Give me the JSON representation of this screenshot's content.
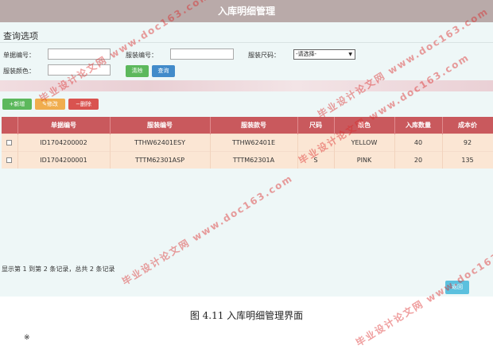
{
  "window": {
    "title": "入库明细管理"
  },
  "query": {
    "section_title": "查询选项",
    "doc_no_label": "单据编号：",
    "clothing_no_label": "服装编号：",
    "size_label": "服装尺码：",
    "size_selected": "-请选择-",
    "color_label": "服装颜色：",
    "clear_label": "清除",
    "search_label": "查询"
  },
  "toolbar": {
    "add_label": "+新增",
    "edit_label": "✎修改",
    "delete_label": "−删除"
  },
  "table": {
    "headers": [
      "",
      "单据编号",
      "服装编号",
      "服装款号",
      "尺码",
      "颜色",
      "入库数量",
      "成本价"
    ],
    "rows": [
      [
        "",
        "ID1704200002",
        "TTHW62401ESY",
        "TTHW62401E",
        "",
        "YELLOW",
        "40",
        "92"
      ],
      [
        "",
        "ID1704200001",
        "TTTM62301ASP",
        "TTTM62301A",
        "S",
        "PINK",
        "20",
        "135"
      ]
    ]
  },
  "pager": {
    "text": "显示第 1 到第 2 条记录，总共 2 条记录"
  },
  "footer": {
    "back_label": "返回"
  },
  "caption": "图 4.11 入库明细管理界面",
  "stray_mark": "※",
  "watermark": "毕业设计论文网 www.doc163.com",
  "colors": {
    "header_bg": "#c9595d",
    "row_bg": "#fbe6d4",
    "title_bg": "#b9aaa9",
    "page_bg": "#eef7f7"
  }
}
